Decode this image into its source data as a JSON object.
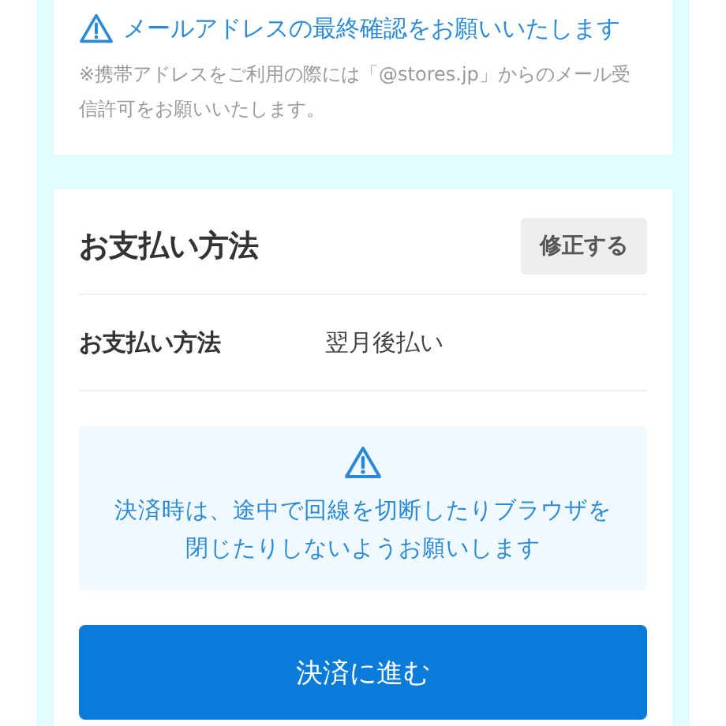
{
  "email_notice": {
    "title": "メールアドレスの最終確認をお願いいたします",
    "note": "※携帯アドレスをご利用の際には「@stores.jp」からのメール受信許可をお願いいたします。"
  },
  "payment": {
    "heading": "お支払い方法",
    "edit_button": "修正する",
    "rows": [
      {
        "label": "お支払い方法",
        "value": "翌月後払い"
      }
    ],
    "warning": "決済時は、途中で回線を切断したりブラウザを閉じたりしないようお願いします",
    "submit_button": "決済に進む"
  }
}
